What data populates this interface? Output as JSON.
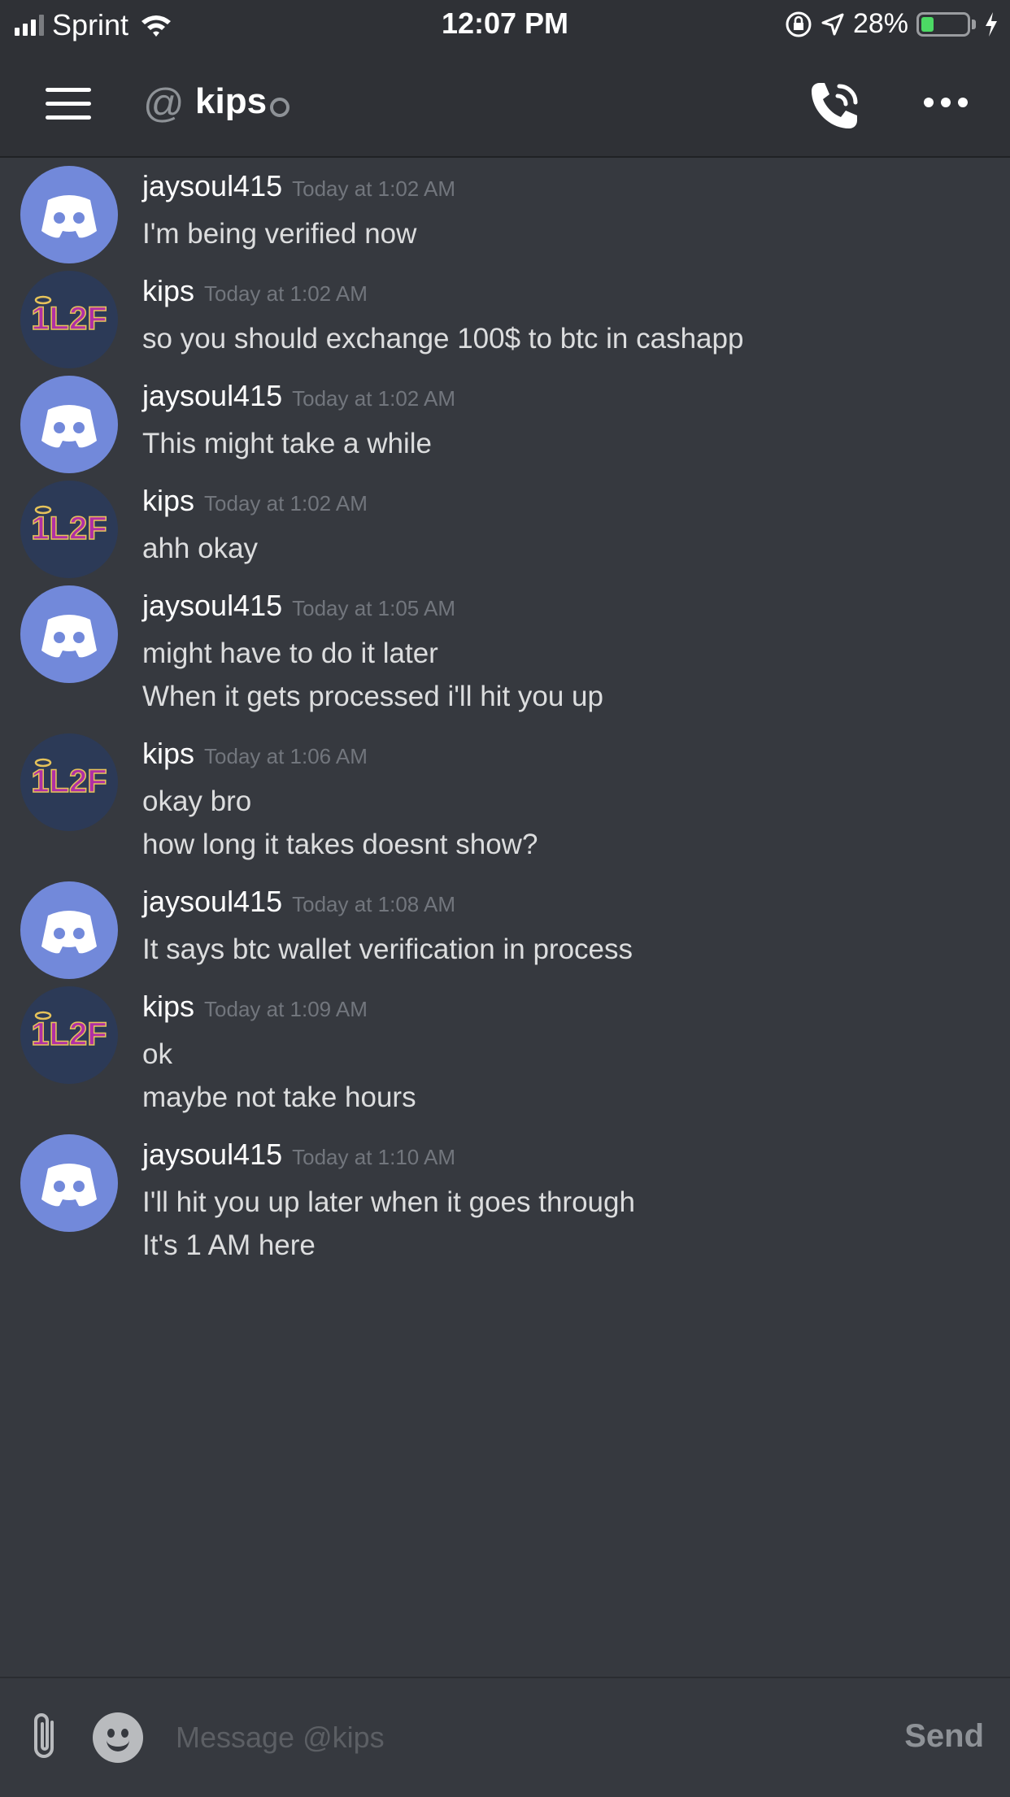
{
  "status_bar": {
    "carrier": "Sprint",
    "time": "12:07 PM",
    "battery_percent_label": "28%",
    "battery_level": 0.28,
    "signal_bars": 3
  },
  "header": {
    "at_symbol": "@",
    "channel_name": "kips"
  },
  "messages": [
    {
      "author": "jaysoul415",
      "avatar": "discord-logo",
      "timestamp": "Today at 1:02 AM",
      "lines": [
        "I'm being verified now"
      ]
    },
    {
      "author": "kips",
      "avatar": "1L2F",
      "timestamp": "Today at 1:02 AM",
      "lines": [
        "so you should exchange 100$ to btc in cashapp"
      ]
    },
    {
      "author": "jaysoul415",
      "avatar": "discord-logo",
      "timestamp": "Today at 1:02 AM",
      "lines": [
        "This might take a while"
      ]
    },
    {
      "author": "kips",
      "avatar": "1L2F",
      "timestamp": "Today at 1:02 AM",
      "lines": [
        "ahh okay"
      ]
    },
    {
      "author": "jaysoul415",
      "avatar": "discord-logo",
      "timestamp": "Today at 1:05 AM",
      "lines": [
        "might have to do it later",
        "When it gets processed i'll hit you up"
      ]
    },
    {
      "author": "kips",
      "avatar": "1L2F",
      "timestamp": "Today at 1:06 AM",
      "lines": [
        "okay bro",
        "how long it takes doesnt show?"
      ]
    },
    {
      "author": "jaysoul415",
      "avatar": "discord-logo",
      "timestamp": "Today at 1:08 AM",
      "lines": [
        "It says btc wallet verification in process"
      ]
    },
    {
      "author": "kips",
      "avatar": "1L2F",
      "timestamp": "Today at 1:09 AM",
      "lines": [
        "ok",
        "maybe not take hours"
      ]
    },
    {
      "author": "jaysoul415",
      "avatar": "discord-logo",
      "timestamp": "Today at 1:10 AM",
      "lines": [
        "I'll hit you up later when it goes through",
        "It's 1 AM here"
      ]
    }
  ],
  "composer": {
    "placeholder": "Message @kips",
    "send_label": "Send"
  },
  "colors": {
    "background": "#36393f",
    "header": "#2f3136",
    "blurple": "#7289da",
    "timestamp": "#72767d"
  }
}
